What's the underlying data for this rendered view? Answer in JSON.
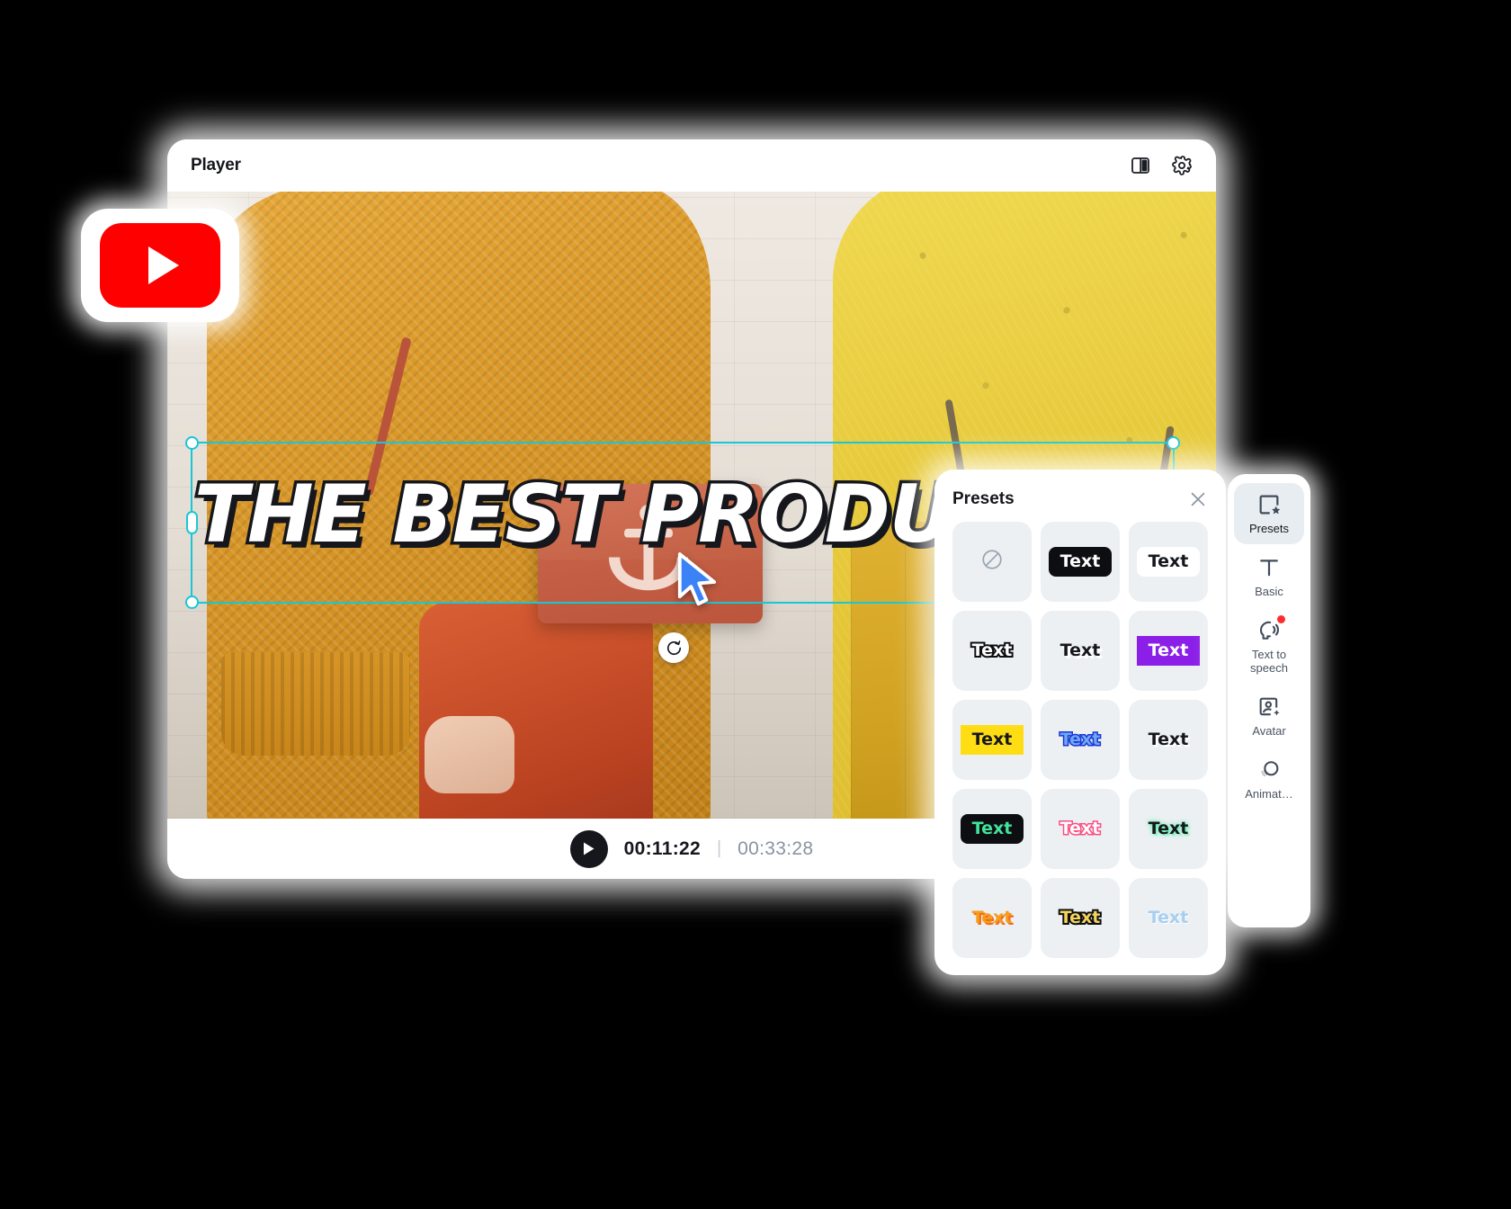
{
  "player": {
    "title": "Player",
    "header_icons": [
      {
        "name": "split-view-icon",
        "glyph": "split-view"
      },
      {
        "name": "settings-gear-icon",
        "glyph": "gear"
      }
    ],
    "overlay_text": "THE BEST PRODUCTS TO SELL",
    "playback": {
      "play_label": "play",
      "current_time": "00:11:22",
      "separator": "|",
      "total_time": "00:33:28"
    },
    "rotate_handle_label": "rotate"
  },
  "youtube_badge": {
    "name": "youtube-logo",
    "label": "YouTube"
  },
  "presets_panel": {
    "title": "Presets",
    "close_label": "Close",
    "items": [
      {
        "label": "",
        "style": "none",
        "name": "preset-none"
      },
      {
        "label": "Text",
        "style": "black-pill",
        "name": "preset-black-pill"
      },
      {
        "label": "Text",
        "style": "white-pill",
        "name": "preset-white-pill"
      },
      {
        "label": "Text",
        "style": "outline-black",
        "name": "preset-outline-black"
      },
      {
        "label": "Text",
        "style": "shadow-white",
        "name": "preset-shadow-white"
      },
      {
        "label": "Text",
        "style": "purple-block",
        "name": "preset-purple-block"
      },
      {
        "label": "Text",
        "style": "yellow-block",
        "name": "preset-yellow-block"
      },
      {
        "label": "Text",
        "style": "blue-outline",
        "name": "preset-blue-outline"
      },
      {
        "label": "Text",
        "style": "black-shadow",
        "name": "preset-black-shadow"
      },
      {
        "label": "Text",
        "style": "green-on-black",
        "name": "preset-green-on-black"
      },
      {
        "label": "Text",
        "style": "pink-outline",
        "name": "preset-pink-outline"
      },
      {
        "label": "Text",
        "style": "green-glow",
        "name": "preset-green-glow"
      },
      {
        "label": "Text",
        "style": "orange-shadow",
        "name": "preset-orange-shadow"
      },
      {
        "label": "Text",
        "style": "gold-outline",
        "name": "preset-gold-outline"
      },
      {
        "label": "Text",
        "style": "ice-blue",
        "name": "preset-ice-blue"
      }
    ]
  },
  "right_toolbar": {
    "items": [
      {
        "label": "Presets",
        "icon": "presets-star-icon",
        "active": true,
        "badge": false
      },
      {
        "label": "Basic",
        "icon": "text-t-icon",
        "active": false,
        "badge": false
      },
      {
        "label": "Text to speech",
        "icon": "text-to-speech-icon",
        "active": false,
        "badge": true
      },
      {
        "label": "Avatar",
        "icon": "avatar-icon",
        "active": false,
        "badge": false
      },
      {
        "label": "Animat…",
        "icon": "animation-icon",
        "active": false,
        "badge": false
      }
    ]
  },
  "colors": {
    "accent_selection": "#18C7D6",
    "youtube_red": "#FF0000",
    "preset_purple": "#8B1FE8",
    "preset_yellow": "#FFDD15",
    "badge_red": "#FF2D2D",
    "panel_bg": "#FFFFFF",
    "cell_bg": "#ECF0F3"
  }
}
